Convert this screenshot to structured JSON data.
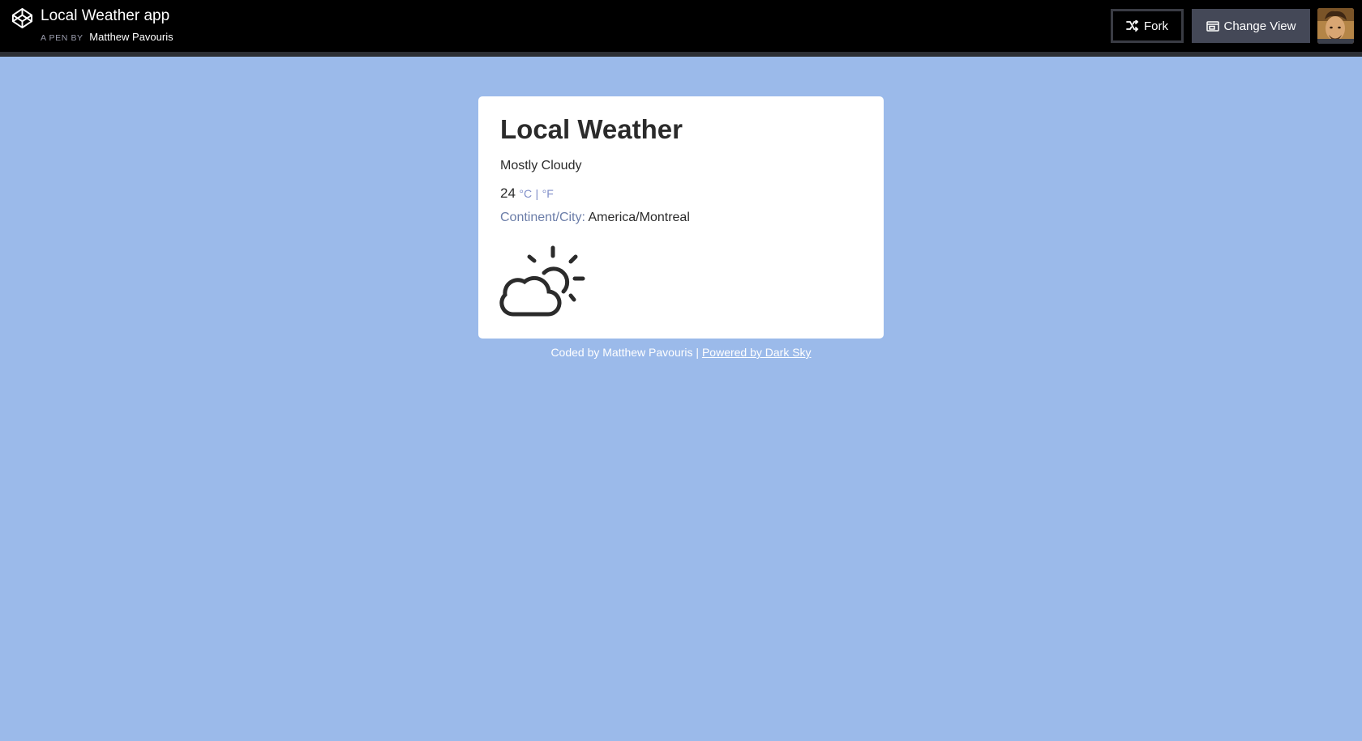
{
  "header": {
    "pen_title": "Local Weather app",
    "pen_by_prefix": "A PEN BY",
    "author": "Matthew Pavouris",
    "fork_label": "Fork",
    "change_view_label": "Change View",
    "icons": {
      "logo": "codepen-logo-icon",
      "fork": "fork-icon",
      "change_view": "change-view-icon"
    }
  },
  "card": {
    "title": "Local Weather",
    "summary": "Mostly Cloudy",
    "temperature": "24",
    "unit_c": "°C",
    "unit_sep": "|",
    "unit_f": "°F",
    "city_label": "Continent/City:",
    "city_value": "America/Montreal",
    "weather_icon": "partly-cloudy-day-icon"
  },
  "footer": {
    "coded_by": "Coded by Matthew Pavouris |",
    "powered_link": "Powered by Dark Sky"
  },
  "colors": {
    "page_background": "#9bbaea",
    "header_background": "#000000",
    "card_background": "#ffffff",
    "accent_unit": "#7f8dc8",
    "city_label": "#6b7da8",
    "text_dark": "#2b2b2b"
  }
}
